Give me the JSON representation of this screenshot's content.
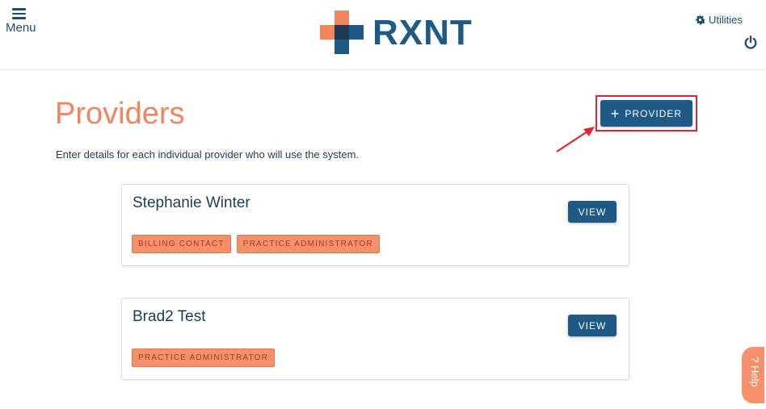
{
  "header": {
    "menu_label": "Menu",
    "logo_text": "RXNT",
    "utilities_label": "Utilities"
  },
  "page": {
    "title": "Providers",
    "subtitle": "Enter details for each individual provider who will use the system.",
    "add_provider_label": "PROVIDER",
    "add_provider_icon": "+"
  },
  "providers": [
    {
      "name": "Stephanie Winter",
      "view_label": "VIEW",
      "roles": [
        "BILLING CONTACT",
        "PRACTICE ADMINISTRATOR"
      ]
    },
    {
      "name": "Brad2 Test",
      "view_label": "VIEW",
      "roles": [
        "PRACTICE ADMINISTRATOR"
      ]
    }
  ],
  "help_label": "? Help",
  "colors": {
    "brand_blue": "#1f5a86",
    "accent_orange": "#f4845f",
    "highlight_red": "#e3242b"
  }
}
